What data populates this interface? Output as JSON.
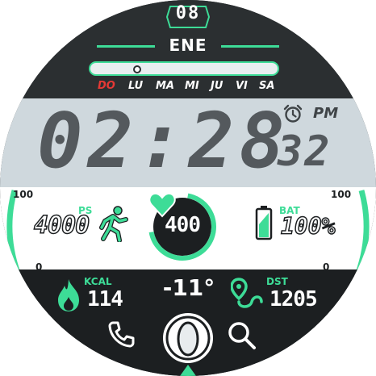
{
  "date": {
    "day": "08",
    "month": "ENE"
  },
  "weekdays": [
    "DO",
    "LU",
    "MA",
    "MI",
    "JU",
    "VI",
    "SA"
  ],
  "time": {
    "hours_minutes": "02:28",
    "seconds": "32",
    "ampm": "PM"
  },
  "gauges": {
    "left_max": "100",
    "left_min": "0",
    "right_max": "100",
    "right_min": "0"
  },
  "steps": {
    "label": "PS",
    "value": "4000"
  },
  "heart_rate": {
    "value": "400"
  },
  "battery": {
    "label": "BAT",
    "value": "100%"
  },
  "calories": {
    "label": "KCAL",
    "value": "114"
  },
  "temperature": {
    "value": "-11°"
  },
  "distance": {
    "label": "DST",
    "value": "1205"
  },
  "icons": [
    "alarm-icon",
    "running-person-icon",
    "heart-icon",
    "battery-icon",
    "flame-icon",
    "route-pin-icon",
    "phone-icon",
    "search-icon"
  ],
  "colors": {
    "accent": "#3ddc97",
    "sunday": "#e53935",
    "lcd": "#cfd8dd",
    "dark": "#1c1f21"
  }
}
